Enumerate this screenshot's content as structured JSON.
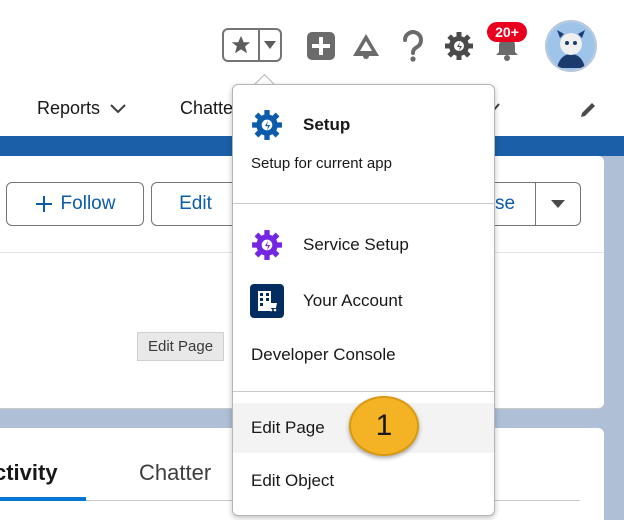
{
  "header": {
    "notifications_badge": "20+",
    "icons": [
      "star-icon",
      "chevron-down-icon",
      "add-icon",
      "trailhead-icon",
      "help-icon",
      "gear-icon",
      "bell-icon",
      "avatar"
    ]
  },
  "nav": {
    "reports_label": "Reports",
    "chatter_label_partial": "Chatte"
  },
  "buttons": {
    "follow_label": "Follow",
    "edit_label": "Edit",
    "partial_label": "se"
  },
  "tooltip": {
    "text": "Edit Page"
  },
  "tabs": {
    "activity_label": "ctivity",
    "chatter_label": "Chatter"
  },
  "menu": {
    "setup_title": "Setup",
    "setup_subtitle": "Setup for current app",
    "items": [
      {
        "label": "Service Setup"
      },
      {
        "label": "Your Account"
      },
      {
        "label": "Developer Console"
      },
      {
        "label": "Edit Page"
      },
      {
        "label": "Edit Object"
      }
    ]
  },
  "callout": {
    "number": "1"
  },
  "colors": {
    "brand_blue": "#0b5cab",
    "setup_gear": "#0b5cab",
    "service_purple": "#7526e3",
    "badge_red": "#ea001e",
    "callout_yellow": "#f3b324"
  }
}
